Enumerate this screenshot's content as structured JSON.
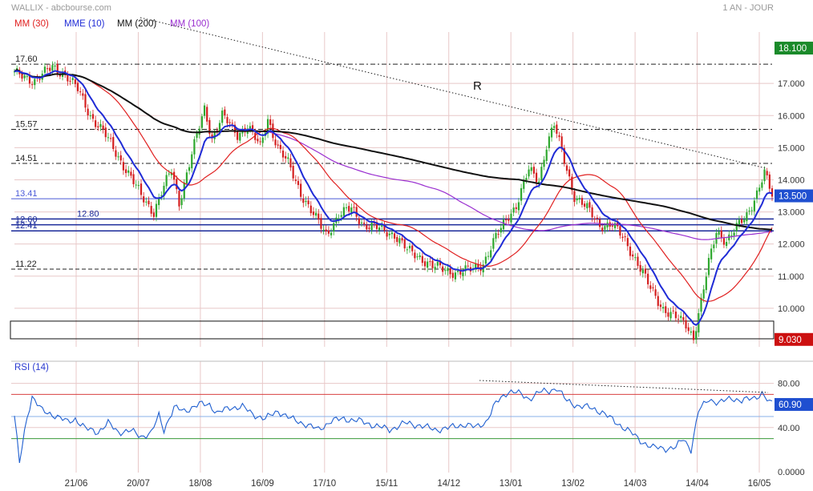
{
  "header": {
    "title": "WALLIX - abcbourse.com",
    "period": "1 AN - JOUR"
  },
  "legend": [
    {
      "label": "MM (30)",
      "color": "#e02020"
    },
    {
      "label": "MME (10)",
      "color": "#1f2bd6"
    },
    {
      "label": "MM (200)",
      "color": "#111111"
    },
    {
      "label": "MM (100)",
      "color": "#9a2fd0"
    }
  ],
  "colors": {
    "up": "#2ea82e",
    "down": "#d42020",
    "grid": "#e8c8c8",
    "last_price_badge": "#1f4fd0",
    "high_badge": "#1a8a2a",
    "low_badge": "#cc1010"
  },
  "chart_data": [
    {
      "type": "line",
      "title": "",
      "subtitle": "",
      "x_tick_labels": [
        "21/06",
        "20/07",
        "18/08",
        "16/09",
        "17/10",
        "15/11",
        "14/12",
        "13/01",
        "13/02",
        "14/03",
        "14/04",
        "16/05"
      ],
      "ylim": [
        8.8,
        18.6
      ],
      "y_tick_labels": [
        "10.000",
        "11.000",
        "12.000",
        "13.000",
        "14.000",
        "15.000",
        "16.000",
        "17.000"
      ],
      "price_badges": {
        "high": "18.100",
        "last": "13.500",
        "low": "9.030"
      },
      "horizontal_levels": [
        {
          "label": "17.60",
          "value": 17.6,
          "style": "dash-dot"
        },
        {
          "label": "15.57",
          "value": 15.57,
          "style": "dash-dot"
        },
        {
          "label": "14.51",
          "value": 14.51,
          "style": "dash-dot"
        },
        {
          "label": "13.41",
          "value": 13.41,
          "style": "solid-blue"
        },
        {
          "label": "12.80",
          "value": 12.78,
          "style": "solid-navy"
        },
        {
          "label": "12.60",
          "value": 12.6,
          "style": "solid-navy"
        },
        {
          "label": "12.41",
          "value": 12.41,
          "style": "solid-navy"
        },
        {
          "label": "11.22",
          "value": 11.22,
          "style": "dash"
        }
      ],
      "support_box": {
        "low": 9.05,
        "high": 9.6
      },
      "trendline_annotation": "R",
      "price_anchors": [
        [
          0,
          17.3
        ],
        [
          8,
          17.1
        ],
        [
          15,
          17.5
        ],
        [
          20,
          17.3
        ],
        [
          25,
          16.8
        ],
        [
          30,
          16.0
        ],
        [
          35,
          15.5
        ],
        [
          45,
          14.2
        ],
        [
          50,
          13.5
        ],
        [
          55,
          13.0
        ],
        [
          58,
          13.6
        ],
        [
          62,
          14.3
        ],
        [
          65,
          13.3
        ],
        [
          70,
          14.8
        ],
        [
          75,
          16.2
        ],
        [
          78,
          15.3
        ],
        [
          82,
          16.0
        ],
        [
          88,
          15.4
        ],
        [
          92,
          15.7
        ],
        [
          97,
          15.0
        ],
        [
          100,
          15.9
        ],
        [
          104,
          15.0
        ],
        [
          108,
          14.5
        ],
        [
          113,
          13.6
        ],
        [
          118,
          12.9
        ],
        [
          123,
          12.3
        ],
        [
          128,
          12.9
        ],
        [
          133,
          13.1
        ],
        [
          138,
          12.6
        ],
        [
          143,
          12.5
        ],
        [
          150,
          12.3
        ],
        [
          155,
          11.8
        ],
        [
          160,
          11.6
        ],
        [
          165,
          11.3
        ],
        [
          170,
          11.2
        ],
        [
          175,
          11.1
        ],
        [
          180,
          11.2
        ],
        [
          185,
          11.4
        ],
        [
          190,
          12.2
        ],
        [
          195,
          12.9
        ],
        [
          198,
          13.2
        ],
        [
          203,
          14.3
        ],
        [
          207,
          14.0
        ],
        [
          210,
          15.1
        ],
        [
          213,
          15.7
        ],
        [
          217,
          14.6
        ],
        [
          221,
          13.5
        ],
        [
          226,
          13.1
        ],
        [
          231,
          12.6
        ],
        [
          236,
          12.6
        ],
        [
          241,
          12.1
        ],
        [
          246,
          11.4
        ],
        [
          251,
          10.6
        ],
        [
          256,
          10.0
        ],
        [
          261,
          9.7
        ],
        [
          265,
          9.5
        ],
        [
          268,
          9.1
        ],
        [
          271,
          10.2
        ],
        [
          274,
          11.4
        ],
        [
          277,
          12.4
        ],
        [
          281,
          12.1
        ],
        [
          285,
          12.5
        ],
        [
          289,
          12.9
        ],
        [
          293,
          13.6
        ],
        [
          296,
          14.2
        ],
        [
          299,
          13.5
        ]
      ],
      "rsi": {
        "label": "RSI (14)",
        "ylim": [
          0,
          100
        ],
        "tick_labels": [
          "80.00",
          "40.00",
          "0.0000"
        ],
        "overbought": 70,
        "oversold": 30,
        "middle": 50,
        "last": "60.90",
        "anchors": [
          [
            0,
            50
          ],
          [
            2,
            8
          ],
          [
            5,
            50
          ],
          [
            7,
            68
          ],
          [
            11,
            55
          ],
          [
            16,
            51
          ],
          [
            21,
            45
          ],
          [
            24,
            48
          ],
          [
            28,
            39
          ],
          [
            33,
            36
          ],
          [
            37,
            44
          ],
          [
            41,
            36
          ],
          [
            46,
            37
          ],
          [
            50,
            32
          ],
          [
            54,
            35
          ],
          [
            57,
            51
          ],
          [
            59,
            38
          ],
          [
            63,
            58
          ],
          [
            67,
            55
          ],
          [
            73,
            61
          ],
          [
            77,
            61
          ],
          [
            80,
            53
          ],
          [
            85,
            58
          ],
          [
            90,
            59
          ],
          [
            94,
            52
          ],
          [
            99,
            48
          ],
          [
            104,
            55
          ],
          [
            109,
            48
          ],
          [
            115,
            43
          ],
          [
            120,
            38
          ],
          [
            125,
            46
          ],
          [
            130,
            48
          ],
          [
            136,
            46
          ],
          [
            142,
            42
          ],
          [
            148,
            38
          ],
          [
            154,
            44
          ],
          [
            160,
            42
          ],
          [
            166,
            38
          ],
          [
            172,
            40
          ],
          [
            178,
            43
          ],
          [
            182,
            40
          ],
          [
            186,
            45
          ],
          [
            190,
            62
          ],
          [
            195,
            73
          ],
          [
            198,
            72
          ],
          [
            203,
            66
          ],
          [
            207,
            72
          ],
          [
            211,
            73
          ],
          [
            214,
            76
          ],
          [
            218,
            64
          ],
          [
            222,
            60
          ],
          [
            227,
            58
          ],
          [
            232,
            54
          ],
          [
            237,
            45
          ],
          [
            242,
            38
          ],
          [
            247,
            28
          ],
          [
            252,
            22
          ],
          [
            257,
            21
          ],
          [
            261,
            22
          ],
          [
            264,
            30
          ],
          [
            267,
            20
          ],
          [
            270,
            55
          ],
          [
            274,
            66
          ],
          [
            278,
            62
          ],
          [
            283,
            67
          ],
          [
            287,
            64
          ],
          [
            292,
            67
          ],
          [
            295,
            71
          ],
          [
            298,
            62
          ]
        ]
      }
    }
  ]
}
